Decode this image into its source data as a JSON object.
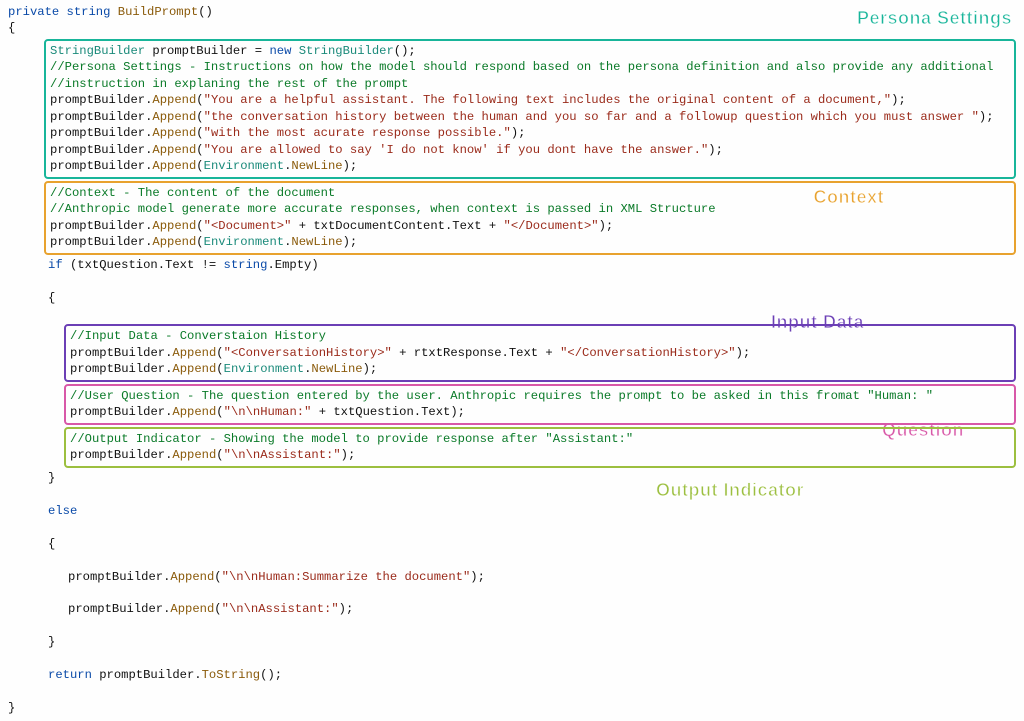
{
  "signature": {
    "kw_private": "private",
    "kw_string": "string",
    "name": "BuildPrompt",
    "parens": "()"
  },
  "braces": {
    "open": "{",
    "close": "}"
  },
  "decl": {
    "type": "StringBuilder",
    "var": "promptBuilder",
    "eq": " = ",
    "kw_new": "new",
    "ctor": "StringBuilder",
    "tail": "();"
  },
  "persona": {
    "label": "Persona Settings",
    "c1": "//Persona Settings - Instructions on how the model should respond based on the persona definition and also provide any additional",
    "c2": "//instruction in explaning the rest of the prompt",
    "l1a": "promptBuilder.",
    "append": "Append",
    "s1": "\"You are a helpful assistant. The following text includes the original content of a document,\"",
    "s2": "\"the conversation history between the human and you so far and a followup question which you must answer \"",
    "s3": "\"with the most acurate response possible.\"",
    "s4": "\"You are allowed to say 'I do not know' if you dont have the answer.\"",
    "env": "Environment",
    "newline": "NewLine",
    "tailp": ");"
  },
  "context": {
    "label": "Context",
    "c1": "//Context - The content of the document",
    "c2": "//Anthropic model generate more accurate responses, when context is passed in XML Structure",
    "s_open": "\"<Document>\"",
    "mid": " + txtDocumentContent.Text + ",
    "s_close": "\"</Document>\""
  },
  "ifline": {
    "kw_if": "if",
    "cond1": " (txtQuestion.Text != ",
    "kw_string": "string",
    "empty": ".Empty)",
    "kw_else": "else"
  },
  "input": {
    "label": "Input Data",
    "c1": "//Input Data - Converstaion History",
    "s_open": "\"<ConversationHistory>\"",
    "mid": " + rtxtResponse.Text + ",
    "s_close": "\"</ConversationHistory>\""
  },
  "question": {
    "label": "Question",
    "c1": "//User Question - The question entered by the user. Anthropic requires the prompt to be asked in this fromat \"Human: \"",
    "s": "\"\\n\\nHuman:\"",
    "mid": " + txtQuestion.Text);"
  },
  "output": {
    "label": "Output Indicator",
    "c1": "//Output Indicator - Showing the model to provide response after \"Assistant:\"",
    "s": "\"\\n\\nAssistant:\""
  },
  "elseblk": {
    "s1": "\"\\n\\nHuman:Summarize the document\"",
    "s2": "\"\\n\\nAssistant:\""
  },
  "ret": {
    "kw_return": "return",
    "body": " promptBuilder.",
    "tostr": "ToString",
    "tail": "();"
  }
}
